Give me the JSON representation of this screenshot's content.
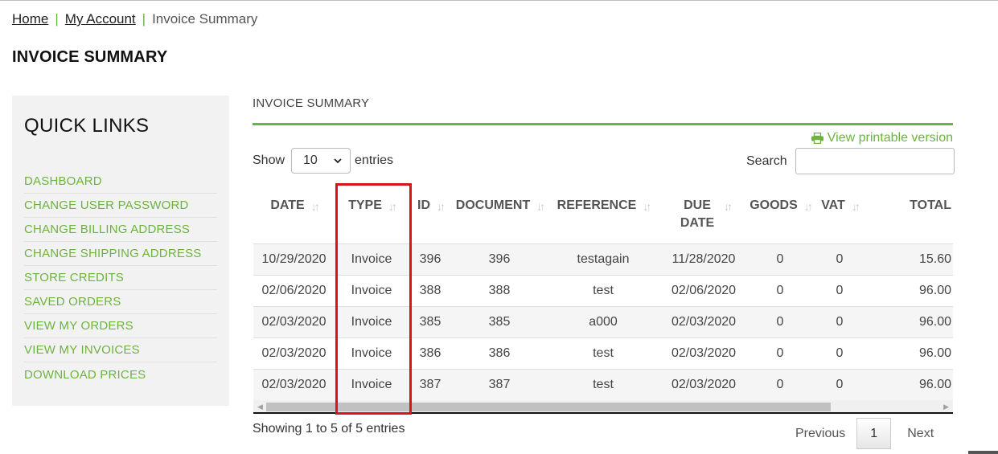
{
  "breadcrumb": {
    "home": "Home",
    "sep": "|",
    "account": "My Account",
    "current": "Invoice Summary"
  },
  "page_title": "INVOICE SUMMARY",
  "sidebar": {
    "title": "QUICK LINKS",
    "items": [
      {
        "label": "DASHBOARD"
      },
      {
        "label": "CHANGE USER PASSWORD"
      },
      {
        "label": "CHANGE BILLING ADDRESS"
      },
      {
        "label": "CHANGE SHIPPING ADDRESS"
      },
      {
        "label": "STORE CREDITS"
      },
      {
        "label": "SAVED ORDERS"
      },
      {
        "label": "VIEW MY ORDERS"
      },
      {
        "label": "VIEW MY INVOICES"
      },
      {
        "label": "DOWNLOAD PRICES"
      }
    ]
  },
  "main": {
    "heading": "INVOICE SUMMARY",
    "print_link": "View printable version",
    "print_icon": "printer-icon",
    "show_label": "Show",
    "show_value": "10",
    "entries_label": "entries",
    "search_label": "Search",
    "search_value": ""
  },
  "table": {
    "columns": [
      "DATE",
      "TYPE",
      "ID",
      "DOCUMENT",
      "REFERENCE",
      "DUE DATE",
      "GOODS",
      "VAT",
      "TOTAL"
    ],
    "rows": [
      [
        "10/29/2020",
        "Invoice",
        "396",
        "396",
        "testagain",
        "11/28/2020",
        "0",
        "0",
        "15.60"
      ],
      [
        "02/06/2020",
        "Invoice",
        "388",
        "388",
        "test",
        "02/06/2020",
        "0",
        "0",
        "96.00"
      ],
      [
        "02/03/2020",
        "Invoice",
        "385",
        "385",
        "a000",
        "02/03/2020",
        "0",
        "0",
        "96.00"
      ],
      [
        "02/03/2020",
        "Invoice",
        "386",
        "386",
        "test",
        "02/03/2020",
        "0",
        "0",
        "96.00"
      ],
      [
        "02/03/2020",
        "Invoice",
        "387",
        "387",
        "test",
        "02/03/2020",
        "0",
        "0",
        "96.00"
      ]
    ]
  },
  "footer": {
    "info": "Showing 1 to 5 of 5 entries",
    "previous": "Previous",
    "page": "1",
    "next": "Next"
  },
  "colors": {
    "accent": "#6db33f",
    "highlight": "#d9121b"
  }
}
